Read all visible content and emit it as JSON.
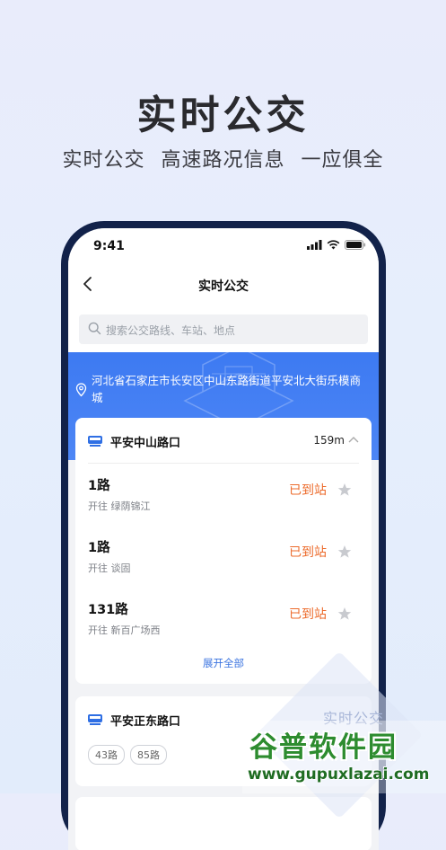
{
  "promo": {
    "title": "实时公交",
    "subtitle": "实时公交  高速路况信息  一应俱全"
  },
  "status_bar": {
    "time": "9:41"
  },
  "nav": {
    "title": "实时公交",
    "back_icon": "chevron-left-icon"
  },
  "search": {
    "placeholder": "搜索公交路线、车站、地点",
    "icon": "search-icon"
  },
  "location": {
    "address": "河北省石家庄市长安区中山东路街道平安北大街乐模商城",
    "icon": "location-pin-icon"
  },
  "stops": [
    {
      "name": "平安中山路口",
      "distance": "159m",
      "routes": [
        {
          "name": "1路",
          "direction": "开往 绿荫锦江",
          "status": "已到站"
        },
        {
          "name": "1路",
          "direction": "开往 谈固",
          "status": "已到站"
        },
        {
          "name": "131路",
          "direction": "开往 新百广场西",
          "status": "已到站"
        }
      ],
      "expand_label": "展开全部"
    },
    {
      "name": "平安正东路口",
      "tags": [
        "43路",
        "85路"
      ]
    }
  ],
  "watermark": {
    "badge_text": "实时公交",
    "site_name": "谷普软件园",
    "site_url": "www.gupuxlazai.com"
  },
  "colors": {
    "accent_blue": "#3d7af2",
    "status_orange": "#ec6a2a",
    "phone_frame": "#12224a"
  }
}
